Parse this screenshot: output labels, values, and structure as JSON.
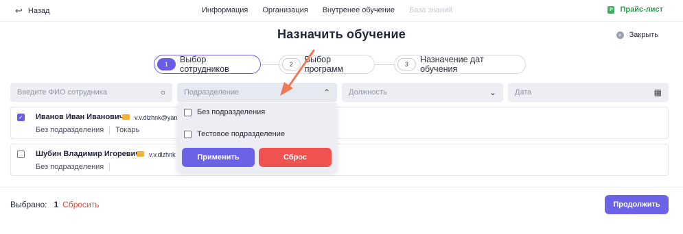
{
  "header": {
    "back_label": "Назад",
    "nav": [
      "Информация",
      "Организация",
      "Внутренее обучение",
      "База знаний"
    ],
    "price_label": "Прайс-лист",
    "price_icon": "P"
  },
  "page": {
    "title": "Назначить обучение",
    "close_label": "Закрыть"
  },
  "steps": [
    {
      "num": "1",
      "label": "Выбор сотрудников"
    },
    {
      "num": "2",
      "label": "Выбор программ"
    },
    {
      "num": "3",
      "label": "Назначение дат обучения"
    }
  ],
  "filters": {
    "name_placeholder": "Введите ФИО сотрудника",
    "department_placeholder": "Подразделение",
    "position_placeholder": "Должность",
    "date_placeholder": "Дата"
  },
  "employees": [
    {
      "name": "Иванов Иван Иванович",
      "email": "v.v.dlzhnk@yan",
      "department": "Без подразделения",
      "position": "Токарь",
      "checked": true
    },
    {
      "name": "Шубин Владимир Игоревич",
      "email": "v.v.dlzhnk",
      "department": "Без подразделения",
      "position": "",
      "checked": false
    }
  ],
  "dropdown": {
    "options": [
      "Без подразделения",
      "Тестовое подразделение"
    ],
    "apply_label": "Применить",
    "reset_label": "Сброс"
  },
  "footer": {
    "selected_label": "Выбрано:",
    "selected_count": "1",
    "reset_link": "Сбросить",
    "continue_label": "Продолжить"
  },
  "colors": {
    "accent": "#6b62e6",
    "danger": "#ef5350",
    "success": "#3fae60",
    "annotation_arrow": "#f07855"
  }
}
